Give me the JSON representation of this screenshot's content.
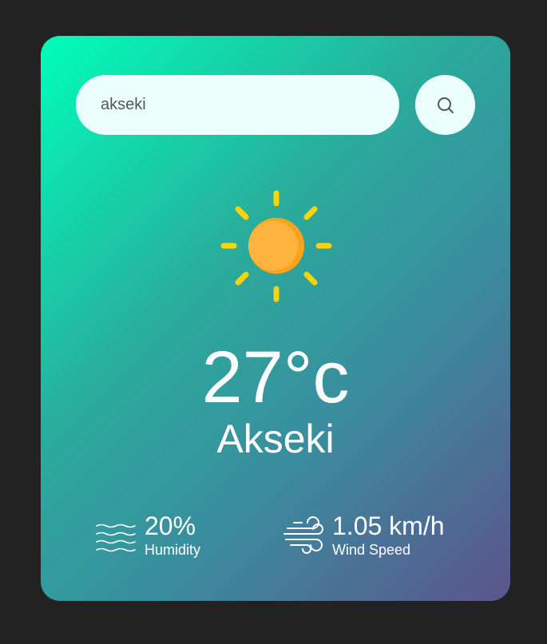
{
  "search": {
    "value": "akseki",
    "button_icon": "search-icon"
  },
  "weather": {
    "condition_icon": "sun-icon",
    "temperature": "27°c",
    "city": "Akseki"
  },
  "details": {
    "humidity": {
      "icon": "humidity-waves-icon",
      "value": "20%",
      "label": "Humidity"
    },
    "wind": {
      "icon": "wind-icon",
      "value": "1.05 km/h",
      "label": "Wind Speed"
    }
  },
  "colors": {
    "background": "#222222",
    "gradient_start": "#00feba",
    "gradient_end": "#5b548e",
    "input_bg": "#ebfffc",
    "sun_core": "#ffb13b",
    "sun_rays": "#ffd400"
  }
}
